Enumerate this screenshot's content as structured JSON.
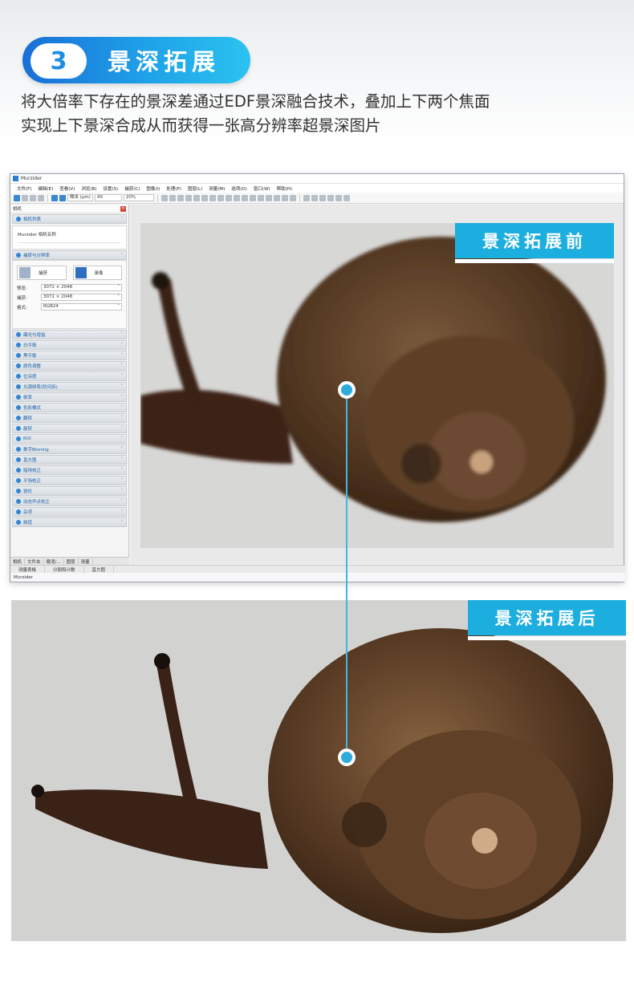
{
  "header": {
    "step_number": "3",
    "title": "景深拓展",
    "description_line1": "将大倍率下存在的景深差通过EDF景深融合技术，叠加上下两个焦面",
    "description_line2": "实现上下景深合成从而获得一张高分辨率超景深图片"
  },
  "app": {
    "window_title": "Murzider",
    "menu": [
      "文件(F)",
      "编辑(E)",
      "查看(V)",
      "浏览(B)",
      "设置(S)",
      "捕获(C)",
      "图像(I)",
      "处理(P)",
      "图层(L)",
      "测量(M)",
      "选项(O)",
      "窗口(W)",
      "帮助(H)"
    ],
    "toolbar": {
      "unit": "微米 (μm)",
      "magnification": "4X",
      "zoom": "20%"
    },
    "panel_title": "相机",
    "sections": {
      "camera_list": "相机列表",
      "camera_item": "Murzider 相机名称",
      "capture": "捕获与分辨率",
      "capture_btn": "捕获",
      "record_btn": "录像",
      "preview_label": "预览:",
      "preview_value": "3072 × 2048",
      "capture_label": "捕获:",
      "capture_value": "3072 × 2048",
      "format_label": "格式:",
      "format_value": "RGB24"
    },
    "settings_sections": [
      "曝光与增益",
      "白平衡",
      "黑平衡",
      "颜色调整",
      "位深度",
      "光源频率(防闪烁)",
      "帧率",
      "色彩模式",
      "翻转",
      "旋转",
      "ROI",
      "数字Binning",
      "直方图",
      "暗场校正",
      "平场校正",
      "锐化",
      "动态坏点校正",
      "杂项",
      "频道"
    ],
    "panel_tabs": [
      "相机",
      "文件夹",
      "撤消/...",
      "图层",
      "测量"
    ],
    "doc_tabs": [
      "测量表格",
      "分割和计数",
      "直方图"
    ],
    "statusbar": "Murzider"
  },
  "labels": {
    "before": "景深拓展前",
    "after": "景深拓展后"
  },
  "colors": {
    "accent": "#1caedf",
    "pill_start": "#1a6fd6",
    "pill_end": "#2bc3ef",
    "connector": "#3fb6e3"
  }
}
